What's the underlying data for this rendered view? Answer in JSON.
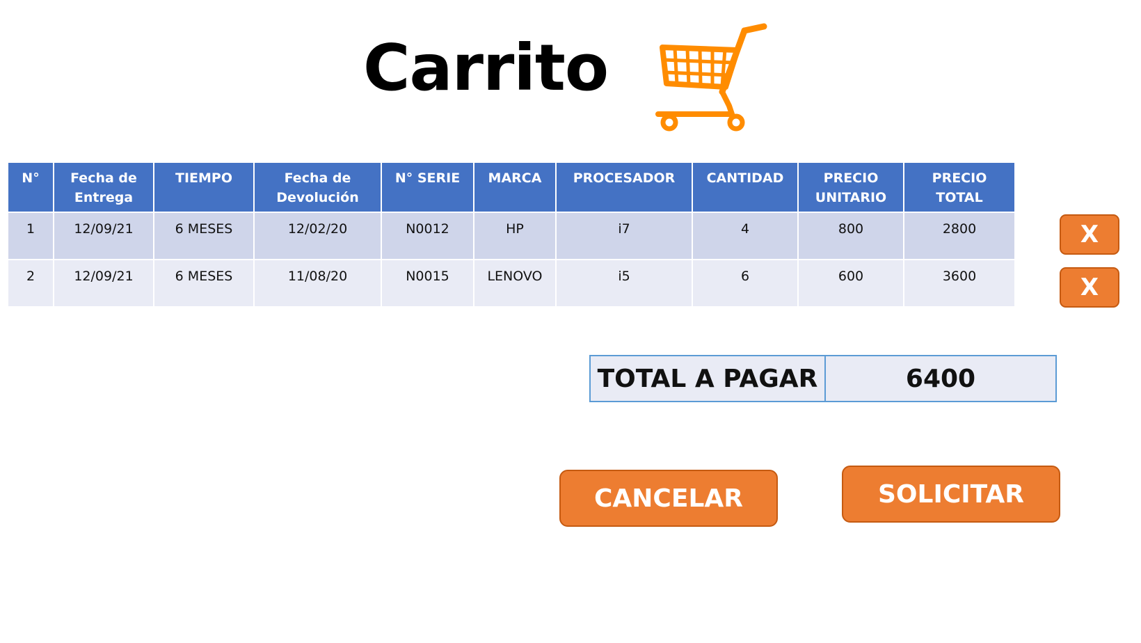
{
  "title": "Carrito",
  "icons": {
    "cart": "shopping-cart-icon"
  },
  "colors": {
    "header_bg": "#4472c4",
    "row_odd": "#cfd5ea",
    "row_even": "#e9ebf5",
    "accent": "#ed7d31",
    "total_border": "#5b9bd5"
  },
  "table": {
    "headers": {
      "num": "N°",
      "fecha_entrega": [
        "Fecha de",
        "Entrega"
      ],
      "tiempo": "TIEMPO",
      "fecha_devolucion": [
        "Fecha de",
        "Devolución"
      ],
      "serie": "N° SERIE",
      "marca": "MARCA",
      "procesador": "PROCESADOR",
      "cantidad": "CANTIDAD",
      "precio_unitario": [
        "PRECIO",
        "UNITARIO"
      ],
      "precio_total": [
        "PRECIO",
        "TOTAL"
      ]
    },
    "rows": [
      {
        "num": "1",
        "fecha_entrega": "12/09/21",
        "tiempo": "6 MESES",
        "fecha_devolucion": "12/02/20",
        "serie": "N0012",
        "marca": "HP",
        "procesador": "i7",
        "cantidad": "4",
        "precio_unitario": "800",
        "precio_total": "2800"
      },
      {
        "num": "2",
        "fecha_entrega": "12/09/21",
        "tiempo": "6 MESES",
        "fecha_devolucion": "11/08/20",
        "serie": "N0015",
        "marca": "LENOVO",
        "procesador": "i5",
        "cantidad": "6",
        "precio_unitario": "600",
        "precio_total": "3600"
      }
    ],
    "delete_label": "X"
  },
  "total": {
    "label": "TOTAL A PAGAR",
    "value": "6400"
  },
  "actions": {
    "cancel_label": "CANCELAR",
    "submit_label": "SOLICITAR"
  }
}
